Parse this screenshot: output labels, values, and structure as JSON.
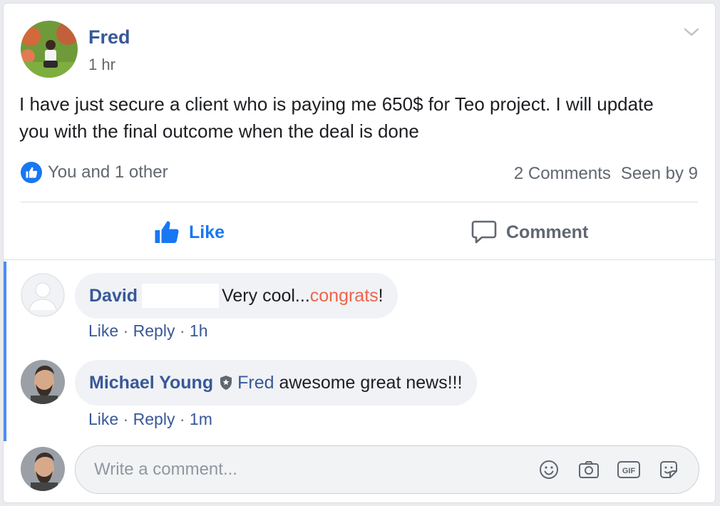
{
  "post": {
    "author": "Fred",
    "time": "1 hr",
    "text": "I have just secure a client who is paying me 650$ for Teo project. I will update you with the final outcome when the deal is done",
    "reactions_text": "You and 1 other",
    "comments_count": "2 Comments",
    "seen_by": "Seen by 9"
  },
  "actions": {
    "like": "Like",
    "comment": "Comment"
  },
  "comments": [
    {
      "author": "David",
      "text_before": "Very cool...",
      "text_highlight": "congrats",
      "text_after": "!",
      "like": "Like",
      "reply": "Reply",
      "time": "1h"
    },
    {
      "author": "Michael Young",
      "mention": "Fred",
      "text": "awesome great news!!!",
      "like": "Like",
      "reply": "Reply",
      "time": "1m"
    }
  ],
  "composer": {
    "placeholder": "Write a comment..."
  },
  "icons": {
    "post_menu": "chevron-down-icon",
    "like_badge": "thumbs-up-icon",
    "like_action": "thumbs-up-icon",
    "comment_action": "speech-bubble-icon",
    "badge": "shield-icon",
    "emoji": "smiley-icon",
    "camera": "camera-icon",
    "gif": "gif-icon",
    "sticker": "sticker-icon"
  },
  "colors": {
    "link_blue": "#385898",
    "like_blue": "#1877f2",
    "highlight": "#f0634a",
    "meta_gray": "#606770"
  },
  "separator": "·"
}
